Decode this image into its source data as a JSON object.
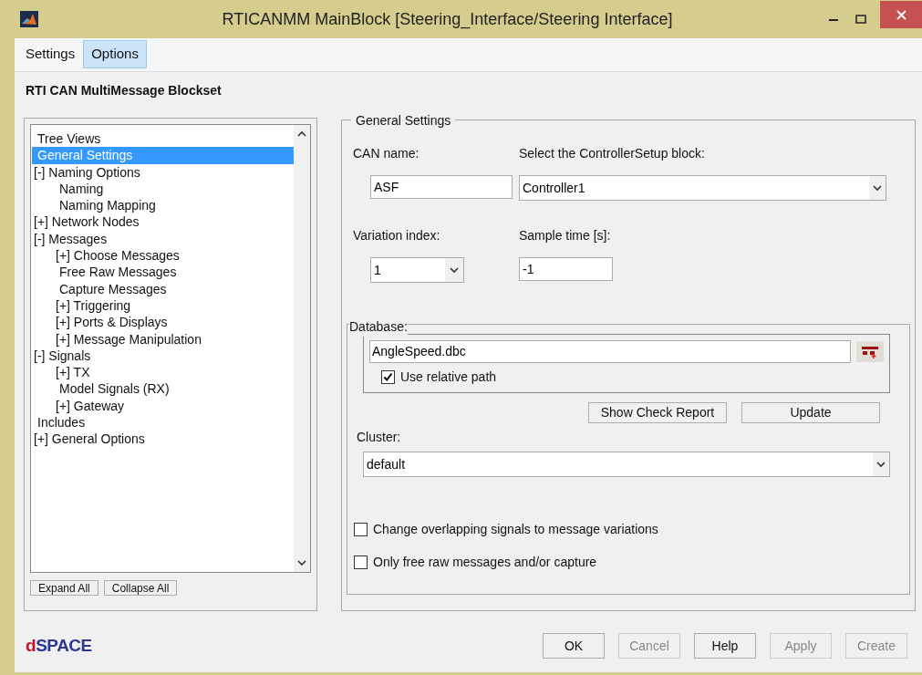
{
  "window": {
    "title": "RTICANMM MainBlock  [Steering_Interface/Steering Interface]"
  },
  "menu": [
    {
      "label": "Settings",
      "selected": false
    },
    {
      "label": "Options",
      "selected": true
    }
  ],
  "header": "RTI CAN MultiMessage Blockset",
  "tree": {
    "items": [
      {
        "label": "Tree Views",
        "selected": false
      },
      {
        "label": "General Settings",
        "selected": true
      },
      {
        "label": "[-] Naming Options",
        "selected": false,
        "children": [
          {
            "label": "Naming",
            "selected": false
          },
          {
            "label": "Naming Mapping",
            "selected": false
          }
        ]
      },
      {
        "label": "[+] Network Nodes",
        "selected": false
      },
      {
        "label": "[-] Messages",
        "selected": false,
        "children": [
          {
            "label": "[+] Choose Messages",
            "selected": false
          },
          {
            "label": "Free Raw Messages",
            "selected": false
          },
          {
            "label": "Capture Messages",
            "selected": false
          },
          {
            "label": "[+] Triggering",
            "selected": false
          },
          {
            "label": "[+] Ports & Displays",
            "selected": false
          },
          {
            "label": "[+] Message Manipulation",
            "selected": false
          }
        ]
      },
      {
        "label": "[-] Signals",
        "selected": false,
        "children": [
          {
            "label": "[+] TX",
            "selected": false
          },
          {
            "label": "Model Signals (RX)",
            "selected": false
          },
          {
            "label": "[+] Gateway",
            "selected": false
          }
        ]
      },
      {
        "label": "Includes",
        "selected": false
      },
      {
        "label": "[+] General Options",
        "selected": false
      }
    ],
    "buttons": [
      "Expand All",
      "Collapse All"
    ]
  },
  "general": {
    "title": "General Settings",
    "can_name": {
      "label": "CAN name:",
      "value": "ASF"
    },
    "controller": {
      "label": "Select the ControllerSetup block:",
      "value": "Controller1"
    },
    "variation": {
      "label": "Variation index:",
      "value": "1"
    },
    "sample_time": {
      "label": "Sample time [s]:",
      "value": "-1"
    },
    "database": {
      "title": "Database:",
      "file": "AngleSpeed.dbc",
      "relative_path": {
        "label": "Use relative path",
        "checked": true
      },
      "buttons": [
        "Show Check Report",
        "Update"
      ]
    },
    "cluster": {
      "label": "Cluster:",
      "value": "default"
    },
    "options": [
      {
        "label": "Change overlapping signals to message variations",
        "checked": false
      },
      {
        "label": "Only free raw messages and/or capture",
        "checked": false
      }
    ]
  },
  "logo": {
    "first": "d",
    "rest": "SPACE"
  },
  "buttons": [
    {
      "label": "OK",
      "disabled": false
    },
    {
      "label": "Cancel",
      "disabled": true
    },
    {
      "label": "Help",
      "disabled": false
    },
    {
      "label": "Apply",
      "disabled": true
    },
    {
      "label": "Create",
      "disabled": true
    }
  ]
}
